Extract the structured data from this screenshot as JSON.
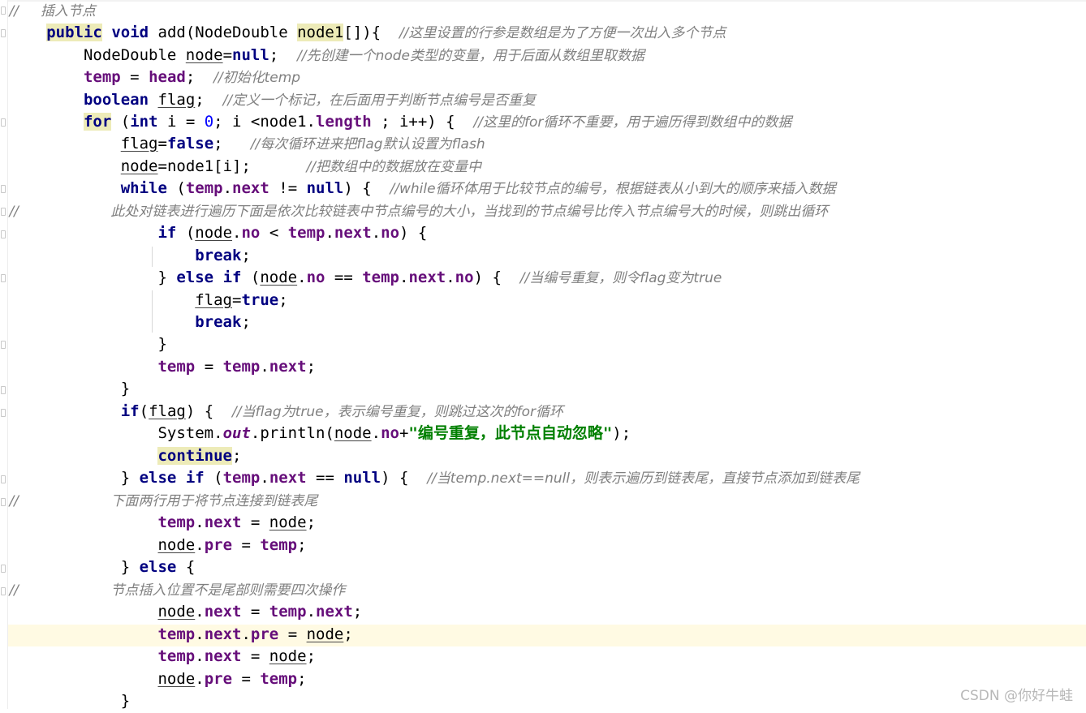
{
  "editor": {
    "lines": [
      [
        [
          "cm",
          "//     插入节点"
        ]
      ],
      [
        [
          "t",
          "    "
        ],
        [
          "kwm",
          "public"
        ],
        [
          "t",
          " "
        ],
        [
          "kw",
          "void"
        ],
        [
          "t",
          " add(NodeDouble "
        ],
        [
          "mark",
          "node1"
        ],
        [
          "t",
          "[]){  "
        ],
        [
          "cm",
          "//这里设置的行参是数组是为了方便一次出入多个节点"
        ]
      ],
      [
        [
          "t",
          "        NodeDouble "
        ],
        [
          "ul",
          "node"
        ],
        [
          "t",
          "="
        ],
        [
          "kw",
          "null"
        ],
        [
          "t",
          ";  "
        ],
        [
          "cm",
          "//先创建一个node类型的变量，用于后面从数组里取数据"
        ]
      ],
      [
        [
          "t",
          "        "
        ],
        [
          "fld",
          "temp"
        ],
        [
          "t",
          " = "
        ],
        [
          "fld",
          "head"
        ],
        [
          "t",
          ";  "
        ],
        [
          "cm",
          "//初始化temp"
        ]
      ],
      [
        [
          "t",
          "        "
        ],
        [
          "kw",
          "boolean"
        ],
        [
          "t",
          " "
        ],
        [
          "ul",
          "flag"
        ],
        [
          "t",
          ";  "
        ],
        [
          "cm",
          "//定义一个标记，在后面用于判断节点编号是否重复"
        ]
      ],
      [
        [
          "t",
          "        "
        ],
        [
          "kwm",
          "for"
        ],
        [
          "t",
          " ("
        ],
        [
          "kw",
          "int"
        ],
        [
          "t",
          " i = "
        ],
        [
          "num",
          "0"
        ],
        [
          "t",
          "; i <node1."
        ],
        [
          "fld",
          "length"
        ],
        [
          "t",
          " ; i++) {  "
        ],
        [
          "cm",
          "//这里的for循环不重要，用于遍历得到数组中的数据"
        ]
      ],
      [
        [
          "t",
          "            "
        ],
        [
          "ul",
          "flag"
        ],
        [
          "t",
          "="
        ],
        [
          "kw",
          "false"
        ],
        [
          "t",
          ";   "
        ],
        [
          "cm",
          "//每次循环进来把flag默认设置为flash"
        ]
      ],
      [
        [
          "t",
          "            "
        ],
        [
          "ul",
          "node"
        ],
        [
          "t",
          "=node1[i];      "
        ],
        [
          "cm",
          "//把数组中的数据放在变量中"
        ]
      ],
      [
        [
          "t",
          "            "
        ],
        [
          "kw",
          "while"
        ],
        [
          "t",
          " ("
        ],
        [
          "fld",
          "temp"
        ],
        [
          "t",
          "."
        ],
        [
          "fld",
          "next"
        ],
        [
          "t",
          " != "
        ],
        [
          "kw",
          "null"
        ],
        [
          "t",
          ") {  "
        ],
        [
          "cm",
          "//while循环体用于比较节点的编号，根据链表从小到大的顺序来插入数据"
        ]
      ],
      [
        [
          "cm",
          "//                     此处对链表进行遍历下面是依次比较链表中节点编号的大小，当找到的节点编号比传入节点编号大的时候，则跳出循环"
        ]
      ],
      [
        [
          "t",
          "                "
        ],
        [
          "kw",
          "if"
        ],
        [
          "t",
          " ("
        ],
        [
          "ul",
          "node"
        ],
        [
          "t",
          "."
        ],
        [
          "fld",
          "no"
        ],
        [
          "t",
          " < "
        ],
        [
          "fld",
          "temp"
        ],
        [
          "t",
          "."
        ],
        [
          "fld",
          "next"
        ],
        [
          "t",
          "."
        ],
        [
          "fld",
          "no"
        ],
        [
          "t",
          ") {"
        ]
      ],
      [
        [
          "t",
          "                    "
        ],
        [
          "kw",
          "break"
        ],
        [
          "t",
          ";"
        ]
      ],
      [
        [
          "t",
          "                } "
        ],
        [
          "kw",
          "else"
        ],
        [
          "t",
          " "
        ],
        [
          "kw",
          "if"
        ],
        [
          "t",
          " ("
        ],
        [
          "ul",
          "node"
        ],
        [
          "t",
          "."
        ],
        [
          "fld",
          "no"
        ],
        [
          "t",
          " == "
        ],
        [
          "fld",
          "temp"
        ],
        [
          "t",
          "."
        ],
        [
          "fld",
          "next"
        ],
        [
          "t",
          "."
        ],
        [
          "fld",
          "no"
        ],
        [
          "t",
          ") {  "
        ],
        [
          "cm",
          "//当编号重复，则令flag变为true"
        ]
      ],
      [
        [
          "t",
          "                    "
        ],
        [
          "ul",
          "flag"
        ],
        [
          "t",
          "="
        ],
        [
          "kw",
          "true"
        ],
        [
          "t",
          ";"
        ]
      ],
      [
        [
          "t",
          "                    "
        ],
        [
          "kw",
          "break"
        ],
        [
          "t",
          ";"
        ]
      ],
      [
        [
          "t",
          "                }"
        ]
      ],
      [
        [
          "t",
          "                "
        ],
        [
          "fld",
          "temp"
        ],
        [
          "t",
          " = "
        ],
        [
          "fld",
          "temp"
        ],
        [
          "t",
          "."
        ],
        [
          "fld",
          "next"
        ],
        [
          "t",
          ";"
        ]
      ],
      [
        [
          "t",
          "            }"
        ]
      ],
      [
        [
          "t",
          "            "
        ],
        [
          "kw",
          "if"
        ],
        [
          "t",
          "("
        ],
        [
          "ul",
          "flag"
        ],
        [
          "t",
          ") {  "
        ],
        [
          "cm",
          "//当flag为true，表示编号重复，则跳过这次的for循环"
        ]
      ],
      [
        [
          "t",
          "                System."
        ],
        [
          "sfld",
          "out"
        ],
        [
          "t",
          ".println("
        ],
        [
          "ul",
          "node"
        ],
        [
          "t",
          "."
        ],
        [
          "fld",
          "no"
        ],
        [
          "t",
          "+"
        ],
        [
          "str",
          "\"编号重复，此节点自动忽略\""
        ],
        [
          "t",
          ");"
        ]
      ],
      [
        [
          "t",
          "                "
        ],
        [
          "kwm",
          "continue"
        ],
        [
          "t",
          ";"
        ]
      ],
      [
        [
          "t",
          "            } "
        ],
        [
          "kw",
          "else"
        ],
        [
          "t",
          " "
        ],
        [
          "kw",
          "if"
        ],
        [
          "t",
          " ("
        ],
        [
          "fld",
          "temp"
        ],
        [
          "t",
          "."
        ],
        [
          "fld",
          "next"
        ],
        [
          "t",
          " == "
        ],
        [
          "kw",
          "null"
        ],
        [
          "t",
          ") {  "
        ],
        [
          "cm",
          "//当temp.next==null，则表示遍历到链表尾，直接节点添加到链表尾"
        ]
      ],
      [
        [
          "cm",
          "//                     下面两行用于将节点连接到链表尾"
        ]
      ],
      [
        [
          "t",
          "                "
        ],
        [
          "fld",
          "temp"
        ],
        [
          "t",
          "."
        ],
        [
          "fld",
          "next"
        ],
        [
          "t",
          " = "
        ],
        [
          "ul",
          "node"
        ],
        [
          "t",
          ";"
        ]
      ],
      [
        [
          "t",
          "                "
        ],
        [
          "ul",
          "node"
        ],
        [
          "t",
          "."
        ],
        [
          "fld",
          "pre"
        ],
        [
          "t",
          " = "
        ],
        [
          "fld",
          "temp"
        ],
        [
          "t",
          ";"
        ]
      ],
      [
        [
          "t",
          "            } "
        ],
        [
          "kw",
          "else"
        ],
        [
          "t",
          " {"
        ]
      ],
      [
        [
          "cm",
          "//                     节点插入位置不是尾部则需要四次操作"
        ]
      ],
      [
        [
          "t",
          "                "
        ],
        [
          "ul",
          "node"
        ],
        [
          "t",
          "."
        ],
        [
          "fld",
          "next"
        ],
        [
          "t",
          " = "
        ],
        [
          "fld",
          "temp"
        ],
        [
          "t",
          "."
        ],
        [
          "fld",
          "next"
        ],
        [
          "t",
          ";"
        ]
      ],
      [
        [
          "t",
          "                "
        ],
        [
          "fld",
          "temp"
        ],
        [
          "t",
          "."
        ],
        [
          "fld",
          "next"
        ],
        [
          "t",
          "."
        ],
        [
          "fld",
          "pre"
        ],
        [
          "t",
          " = "
        ],
        [
          "ul",
          "node"
        ],
        [
          "t",
          ";"
        ]
      ],
      [
        [
          "t",
          "                "
        ],
        [
          "fld",
          "temp"
        ],
        [
          "t",
          "."
        ],
        [
          "fld",
          "next"
        ],
        [
          "t",
          " = "
        ],
        [
          "ul",
          "node"
        ],
        [
          "t",
          ";"
        ]
      ],
      [
        [
          "t",
          "                "
        ],
        [
          "ul",
          "node"
        ],
        [
          "t",
          "."
        ],
        [
          "fld",
          "pre"
        ],
        [
          "t",
          " = "
        ],
        [
          "fld",
          "temp"
        ],
        [
          "t",
          ";"
        ]
      ],
      [
        [
          "t",
          "            }"
        ]
      ]
    ]
  },
  "watermark": "CSDN @你好牛蛙"
}
